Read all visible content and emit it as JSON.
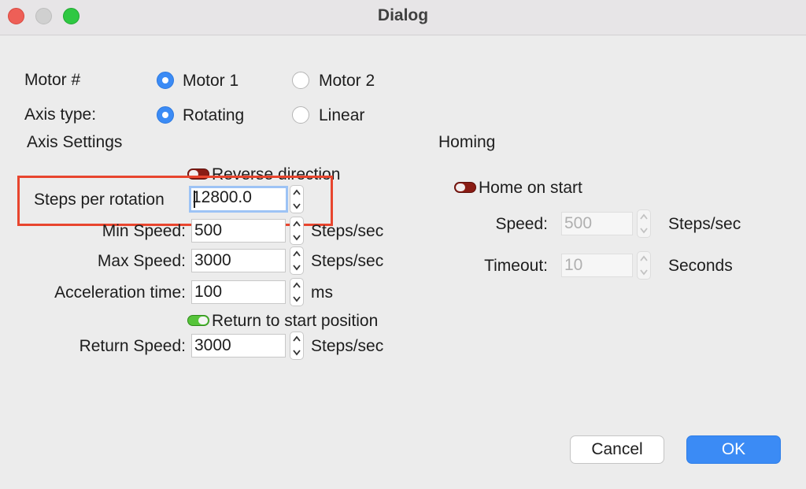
{
  "window": {
    "title": "Dialog"
  },
  "motor": {
    "label": "Motor #",
    "options": [
      "Motor 1",
      "Motor 2"
    ],
    "selected": "Motor 1"
  },
  "axis_type": {
    "label": "Axis type:",
    "options": [
      "Rotating",
      "Linear"
    ],
    "selected": "Rotating"
  },
  "axis_settings": {
    "heading": "Axis Settings",
    "reverse_direction": {
      "label": "Reverse direction",
      "enabled": false
    },
    "steps_per_rotation": {
      "label": "Steps per rotation",
      "value": "12800.0"
    },
    "min_speed": {
      "label": "Min Speed:",
      "value": "500",
      "unit": "Steps/sec"
    },
    "max_speed": {
      "label": "Max Speed:",
      "value": "3000",
      "unit": "Steps/sec"
    },
    "acceleration_time": {
      "label": "Acceleration time:",
      "value": "100",
      "unit": "ms"
    },
    "return_to_start": {
      "label": "Return to start position",
      "enabled": true
    },
    "return_speed": {
      "label": "Return Speed:",
      "value": "3000",
      "unit": "Steps/sec"
    }
  },
  "homing": {
    "heading": "Homing",
    "home_on_start": {
      "label": "Home on start",
      "enabled": false
    },
    "speed": {
      "label": "Speed:",
      "value": "500",
      "unit": "Steps/sec"
    },
    "timeout": {
      "label": "Timeout:",
      "value": "10",
      "unit": "Seconds"
    }
  },
  "buttons": {
    "cancel": "Cancel",
    "ok": "OK"
  },
  "colors": {
    "accent": "#3b8bf5",
    "highlight_box": "#e8452e",
    "toggle_off": "#8a1c14",
    "toggle_on": "#56c43a"
  }
}
